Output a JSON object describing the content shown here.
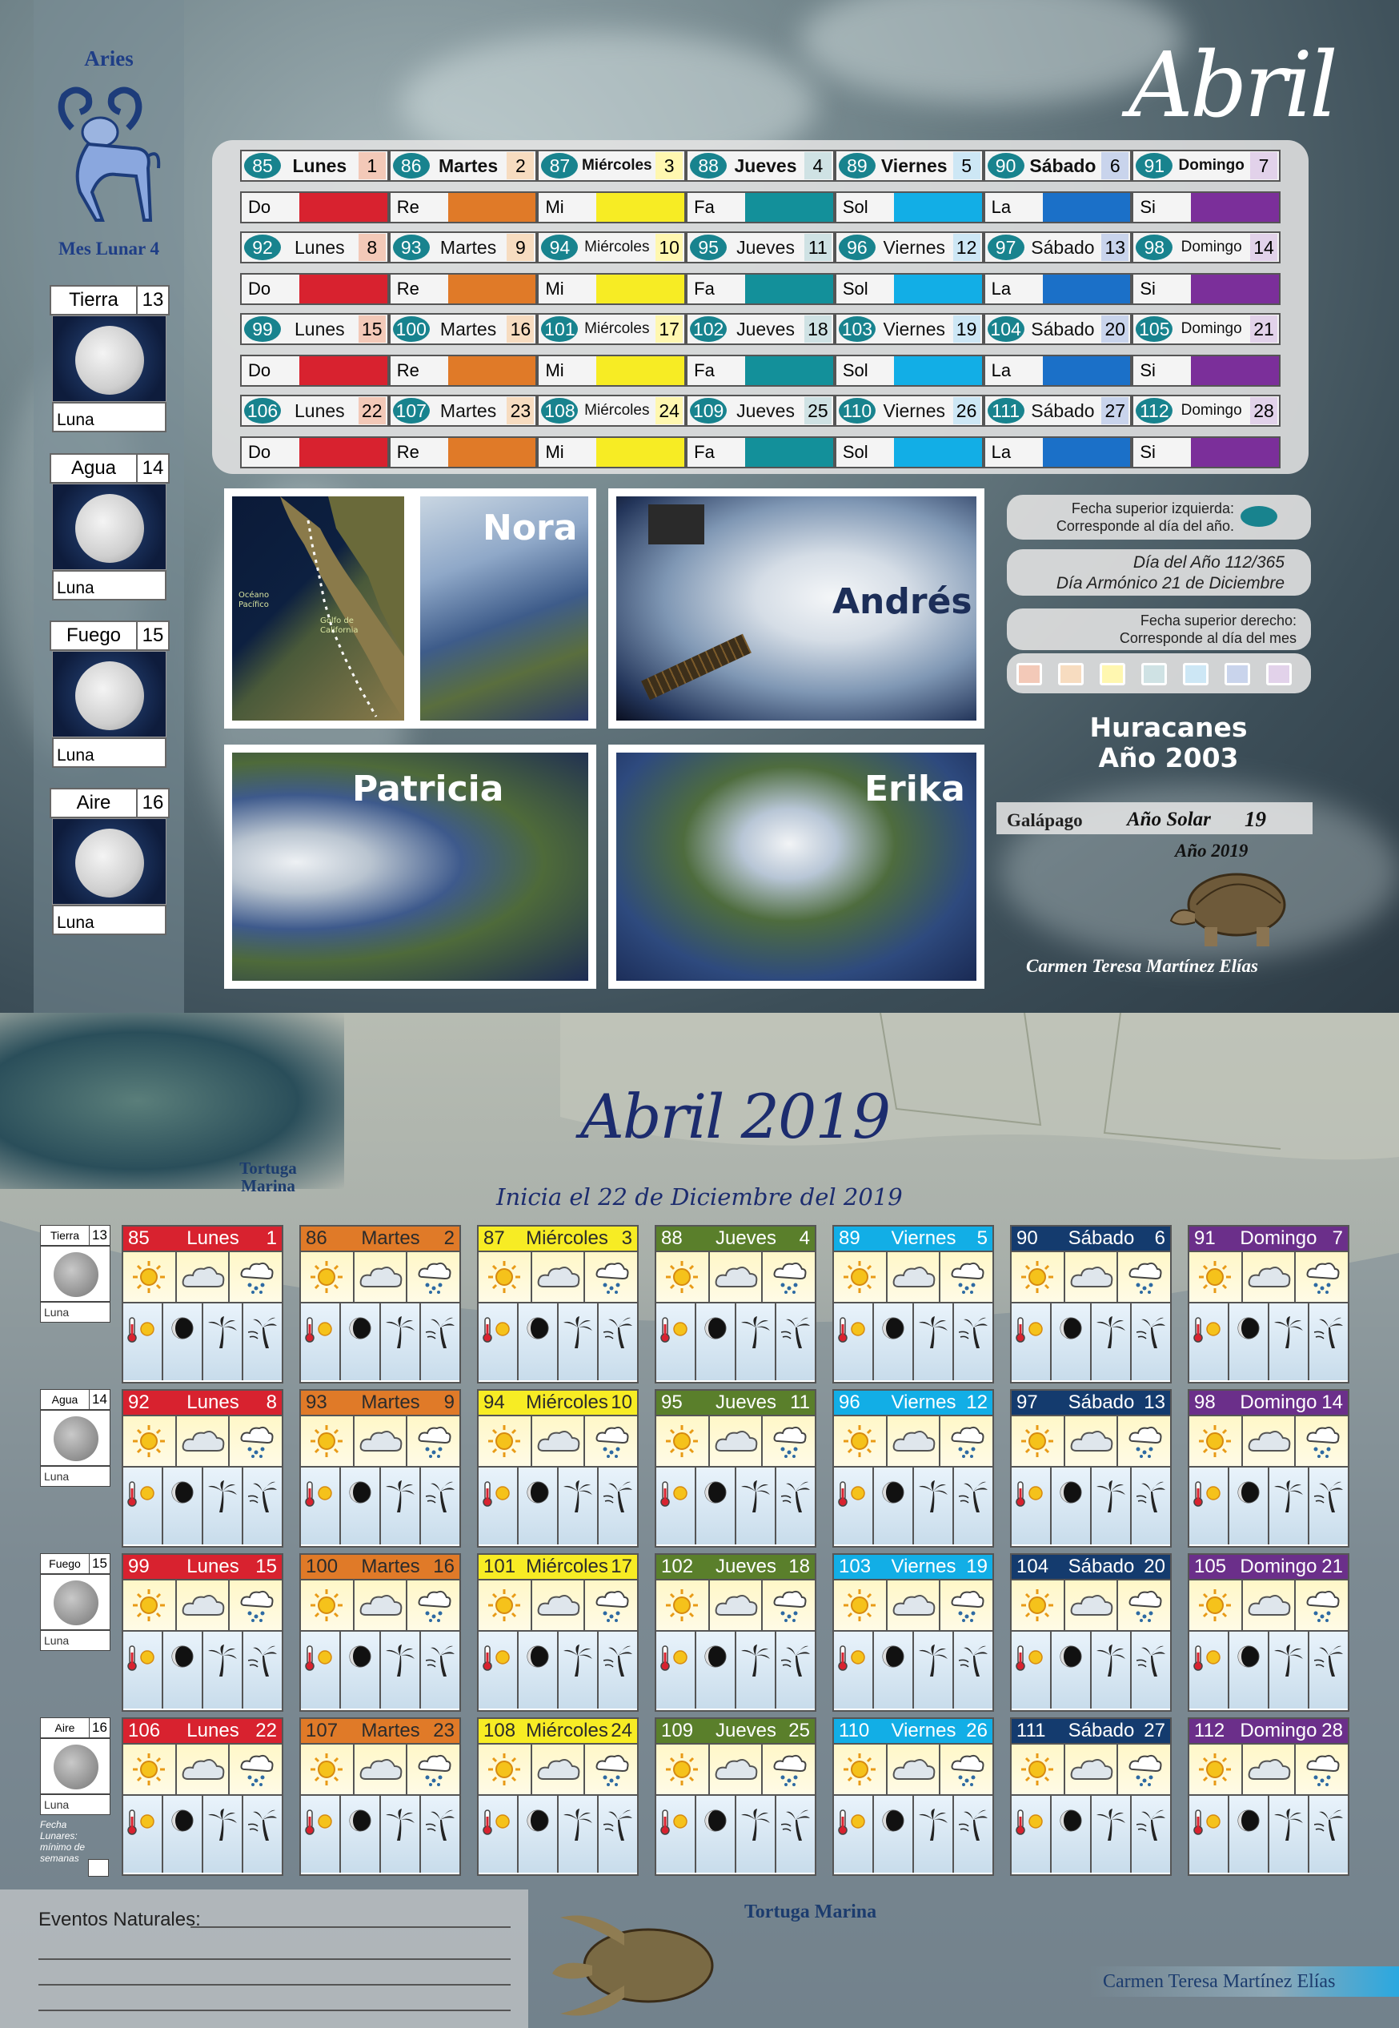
{
  "top": {
    "zodiac": "Aries",
    "lunar_month": "Mes Lunar 4",
    "title": "Abril",
    "elements": [
      {
        "name": "Tierra",
        "num": "13",
        "label": "Luna"
      },
      {
        "name": "Agua",
        "num": "14",
        "label": "Luna"
      },
      {
        "name": "Fuego",
        "num": "15",
        "label": "Luna"
      },
      {
        "name": "Aire",
        "num": "16",
        "label": "Luna"
      }
    ],
    "weeks": [
      {
        "days": [
          {
            "doy": "85",
            "name": "Lunes",
            "dom": "1"
          },
          {
            "doy": "86",
            "name": "Martes",
            "dom": "2"
          },
          {
            "doy": "87",
            "name": "Miércoles",
            "dom": "3"
          },
          {
            "doy": "88",
            "name": "Jueves",
            "dom": "4"
          },
          {
            "doy": "89",
            "name": "Viernes",
            "dom": "5"
          },
          {
            "doy": "90",
            "name": "Sábado",
            "dom": "6"
          },
          {
            "doy": "91",
            "name": "Domingo",
            "dom": "7"
          }
        ]
      },
      {
        "days": [
          {
            "doy": "92",
            "name": "Lunes",
            "dom": "8"
          },
          {
            "doy": "93",
            "name": "Martes",
            "dom": "9"
          },
          {
            "doy": "94",
            "name": "Miércoles",
            "dom": "10"
          },
          {
            "doy": "95",
            "name": "Jueves",
            "dom": "11"
          },
          {
            "doy": "96",
            "name": "Viernes",
            "dom": "12"
          },
          {
            "doy": "97",
            "name": "Sábado",
            "dom": "13"
          },
          {
            "doy": "98",
            "name": "Domingo",
            "dom": "14"
          }
        ]
      },
      {
        "days": [
          {
            "doy": "99",
            "name": "Lunes",
            "dom": "15"
          },
          {
            "doy": "100",
            "name": "Martes",
            "dom": "16"
          },
          {
            "doy": "101",
            "name": "Miércoles",
            "dom": "17"
          },
          {
            "doy": "102",
            "name": "Jueves",
            "dom": "18"
          },
          {
            "doy": "103",
            "name": "Viernes",
            "dom": "19"
          },
          {
            "doy": "104",
            "name": "Sábado",
            "dom": "20"
          },
          {
            "doy": "105",
            "name": "Domingo",
            "dom": "21"
          }
        ]
      },
      {
        "days": [
          {
            "doy": "106",
            "name": "Lunes",
            "dom": "22"
          },
          {
            "doy": "107",
            "name": "Martes",
            "dom": "23"
          },
          {
            "doy": "108",
            "name": "Miércoles",
            "dom": "24"
          },
          {
            "doy": "109",
            "name": "Jueves",
            "dom": "25"
          },
          {
            "doy": "110",
            "name": "Viernes",
            "dom": "26"
          },
          {
            "doy": "111",
            "name": "Sábado",
            "dom": "27"
          },
          {
            "doy": "112",
            "name": "Domingo",
            "dom": "28"
          }
        ]
      }
    ],
    "notes": [
      "Do",
      "Re",
      "Mi",
      "Fa",
      "Sol",
      "La",
      "Si"
    ],
    "note_colors": [
      "#d8222f",
      "#e07a28",
      "#f7ec24",
      "#13909a",
      "#12aee6",
      "#1b70c8",
      "#7b2f9a"
    ],
    "dom_tints": [
      "#f3c9b8",
      "#f7dcc0",
      "#fff7b0",
      "#cfe2e4",
      "#cde7f5",
      "#c9d4ec",
      "#e2d2ea"
    ],
    "photos": {
      "map_label_1": "Océano Pacífico",
      "map_label_2": "Golfo de California",
      "nora": "Nora",
      "andres": "Andrés",
      "patricia": "Patricia",
      "erika": "Erika"
    },
    "info": {
      "top_left_1": "Fecha superior izquierda:",
      "top_left_2": "Corresponde al día del año.",
      "day_of_year": "Día del Año 112/365",
      "harmonic_day": "Día Armónico 21 de Diciembre",
      "top_right_1": "Fecha superior derecho:",
      "top_right_2": "Corresponde al día del mes"
    },
    "huracanes_1": "Huracanes",
    "huracanes_2": "Año 2003",
    "galapago": "Galápago",
    "solar_year_label": "Año Solar",
    "solar_year_num": "19",
    "year": "Año 2019",
    "author": "Carmen Teresa Martínez Elías"
  },
  "bottom": {
    "title": "Abril 2019",
    "subtitle": "Inicia el 22 de Diciembre del 2019",
    "tortuga_top": "Tortuga Marina",
    "tortuga_bottom": "Tortuga Marina",
    "elements": [
      {
        "name": "Tierra",
        "num": "13",
        "label": "Luna"
      },
      {
        "name": "Agua",
        "num": "14",
        "label": "Luna"
      },
      {
        "name": "Fuego",
        "num": "15",
        "label": "Luna"
      },
      {
        "name": "Aire",
        "num": "16",
        "label": "Luna"
      }
    ],
    "weeks": [
      [
        [
          "85",
          "Lunes",
          "1"
        ],
        [
          "86",
          "Martes",
          "2"
        ],
        [
          "87",
          "Miércoles",
          "3"
        ],
        [
          "88",
          "Jueves",
          "4"
        ],
        [
          "89",
          "Viernes",
          "5"
        ],
        [
          "90",
          "Sábado",
          "6"
        ],
        [
          "91",
          "Domingo",
          "7"
        ]
      ],
      [
        [
          "92",
          "Lunes",
          "8"
        ],
        [
          "93",
          "Martes",
          "9"
        ],
        [
          "94",
          "Miércoles",
          "10"
        ],
        [
          "95",
          "Jueves",
          "11"
        ],
        [
          "96",
          "Viernes",
          "12"
        ],
        [
          "97",
          "Sábado",
          "13"
        ],
        [
          "98",
          "Domingo",
          "14"
        ]
      ],
      [
        [
          "99",
          "Lunes",
          "15"
        ],
        [
          "100",
          "Martes",
          "16"
        ],
        [
          "101",
          "Miércoles",
          "17"
        ],
        [
          "102",
          "Jueves",
          "18"
        ],
        [
          "103",
          "Viernes",
          "19"
        ],
        [
          "104",
          "Sábado",
          "20"
        ],
        [
          "105",
          "Domingo",
          "21"
        ]
      ],
      [
        [
          "106",
          "Lunes",
          "22"
        ],
        [
          "107",
          "Martes",
          "23"
        ],
        [
          "108",
          "Miércoles",
          "24"
        ],
        [
          "109",
          "Jueves",
          "25"
        ],
        [
          "110",
          "Viernes",
          "26"
        ],
        [
          "111",
          "Sábado",
          "27"
        ],
        [
          "112",
          "Domingo",
          "28"
        ]
      ]
    ],
    "header_colors": [
      "#d8222f",
      "#e07a28",
      "#f7ec24",
      "#5a7f2b",
      "#12aee6",
      "#143b6e",
      "#6b2f8a"
    ],
    "header_text_colors": [
      "#ffffff",
      "#2b2b2b",
      "#2b2b2b",
      "#ffffff",
      "#ffffff",
      "#ffffff",
      "#ffffff"
    ],
    "fecha_lunar_note": "Fecha Lunares: mínimo de semanas",
    "eventos": "Eventos Naturales:",
    "author": "Carmen Teresa Martínez Elías",
    "icons_row1": [
      "sun-icon",
      "cloud-icon",
      "rain-cloud-icon"
    ],
    "icons_row2": [
      "thermometer-sun-icon",
      "moon-phase-icon",
      "palm-tree-icon",
      "wind-palm-icon"
    ]
  }
}
